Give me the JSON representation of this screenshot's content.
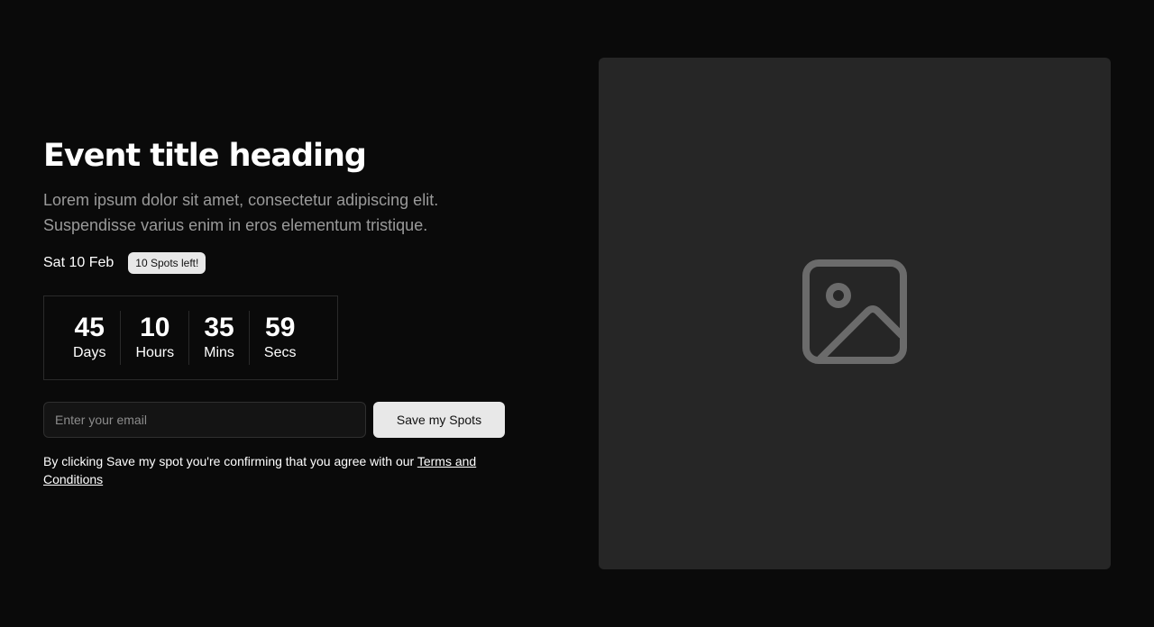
{
  "event": {
    "title": "Event title heading",
    "description": "Lorem ipsum dolor sit amet, consectetur adipiscing elit. Suspendisse varius enim in eros elementum tristique.",
    "date": "Sat 10 Feb",
    "spots_badge": "10 Spots left!"
  },
  "countdown": [
    {
      "value": "45",
      "label": "Days"
    },
    {
      "value": "10",
      "label": "Hours"
    },
    {
      "value": "35",
      "label": "Mins"
    },
    {
      "value": "59",
      "label": "Secs"
    }
  ],
  "form": {
    "email_placeholder": "Enter your email",
    "submit_label": "Save my Spots"
  },
  "terms": {
    "prefix": "By clicking Save my spot you're confirming that you agree with our ",
    "link_text": "Terms and Conditions"
  },
  "media": {
    "icon": "image-placeholder-icon"
  },
  "colors": {
    "background": "#0a0a0a",
    "panel": "#262626",
    "button": "#e8e8e8",
    "muted_text": "#9a9a9a"
  }
}
